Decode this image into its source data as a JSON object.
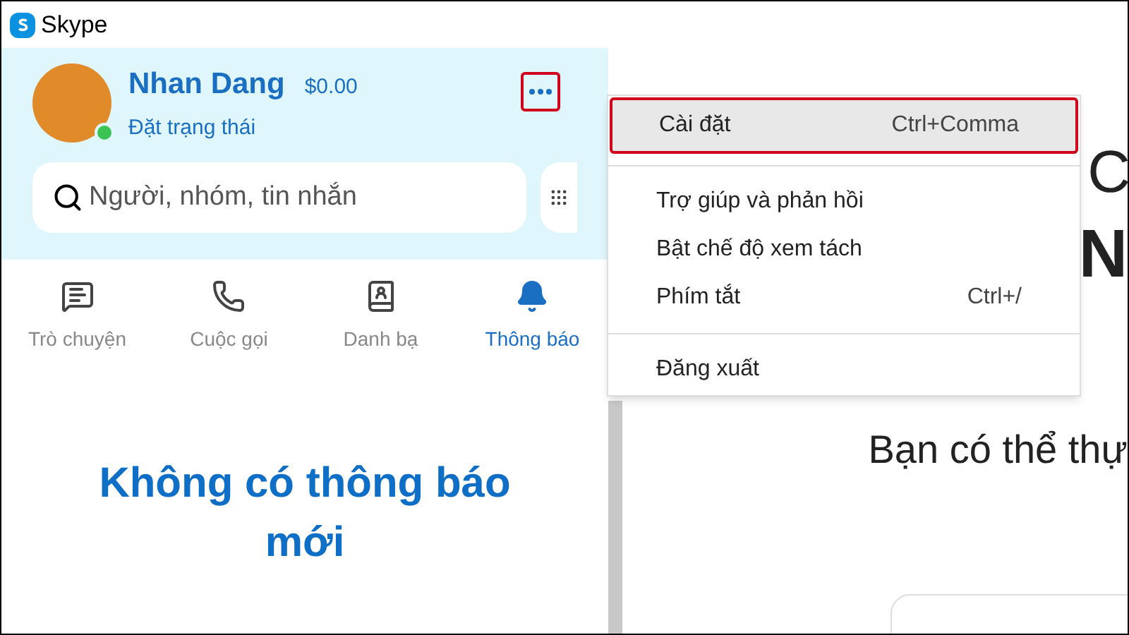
{
  "window": {
    "title": "Skype"
  },
  "profile": {
    "name": "Nhan Dang",
    "balance": "$0.00",
    "status": "Đặt trạng thái",
    "online": true
  },
  "search": {
    "placeholder": "Người, nhóm, tin nhắn"
  },
  "tabs": [
    {
      "label": "Trò chuyện",
      "kind": "chat",
      "selected": false
    },
    {
      "label": "Cuộc gọi",
      "kind": "call",
      "selected": false
    },
    {
      "label": "Danh bạ",
      "kind": "contacts",
      "selected": false
    },
    {
      "label": "Thông báo",
      "kind": "bell",
      "selected": true
    }
  ],
  "empty_title": "Không có thông báo mới",
  "menu": {
    "items": [
      {
        "label": "Cài đặt",
        "shortcut": "Ctrl+Comma",
        "selected": true,
        "divider_after": true
      },
      {
        "label": "Trợ giúp và phản hồi",
        "selected": false,
        "divider_after": false
      },
      {
        "label": "Bật chế độ xem tách",
        "selected": false,
        "divider_after": false
      },
      {
        "label": "Phím tắt",
        "shortcut": "Ctrl+/",
        "selected": false,
        "divider_after": true
      },
      {
        "label": "Đăng xuất",
        "selected": false,
        "divider_after": false
      }
    ]
  },
  "main": {
    "heading_1": "C",
    "heading_2": "N",
    "text": "Bạn có thể thự"
  }
}
